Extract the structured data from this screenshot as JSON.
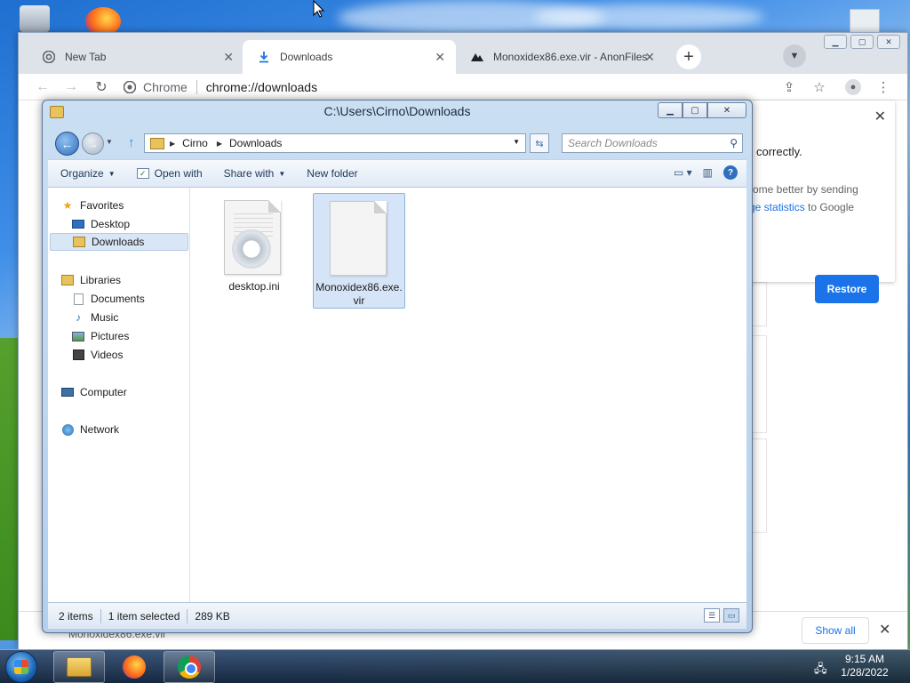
{
  "chrome": {
    "tabs": [
      {
        "label": "New Tab",
        "icon": "chrome-icon"
      },
      {
        "label": "Downloads",
        "icon": "download-icon"
      },
      {
        "label": "Monoxidex86.exe.vir - AnonFiles",
        "icon": "anonfiles-icon"
      }
    ],
    "omnibox": {
      "site": "Chrome",
      "url": "chrome://downloads"
    },
    "restore_card": {
      "line1": "correctly.",
      "line2a": "rome better by sending",
      "line2_link": "ge statistics",
      "line2b": " to Google",
      "button": "Restore"
    },
    "shelf": {
      "item": "Monoxidex86.exe.vir",
      "show_all": "Show all"
    }
  },
  "explorer": {
    "title": "C:\\Users\\Cirno\\Downloads",
    "breadcrumb": [
      "Cirno",
      "Downloads"
    ],
    "search_placeholder": "Search Downloads",
    "commands": {
      "organize": "Organize",
      "open_with": "Open with",
      "share_with": "Share with",
      "new_folder": "New folder"
    },
    "nav": {
      "favorites": "Favorites",
      "desktop": "Desktop",
      "downloads": "Downloads",
      "libraries": "Libraries",
      "documents": "Documents",
      "music": "Music",
      "pictures": "Pictures",
      "videos": "Videos",
      "computer": "Computer",
      "network": "Network"
    },
    "files": [
      {
        "name": "desktop.ini",
        "selected": false
      },
      {
        "name_line1": "Monoxidex86.exe.",
        "name_line2": "vir",
        "selected": true
      }
    ],
    "status": {
      "items": "2 items",
      "selected": "1 item selected",
      "size": "289 KB"
    }
  },
  "taskbar": {
    "time": "9:15 AM",
    "date": "1/28/2022"
  }
}
